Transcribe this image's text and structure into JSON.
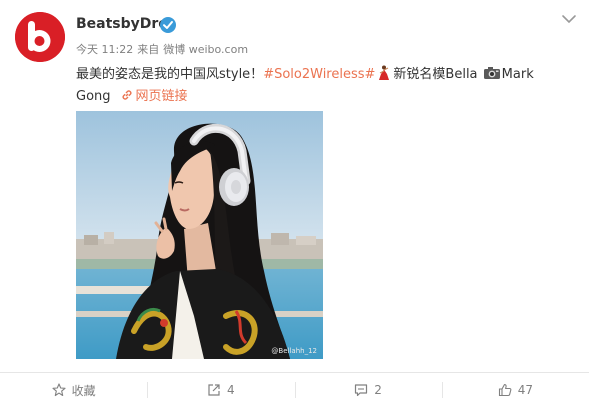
{
  "post": {
    "username": "BeatsbyDre",
    "time": "今天 11:22",
    "source_prefix": "来自",
    "source": "微博 weibo.com",
    "text_main": "最美的姿态是我的中国风style！",
    "topic": "#Solo2Wireless#",
    "model_label": "新锐名模Bella",
    "photographer": "Mark Gong",
    "link_label": "网页链接",
    "photo_watermark": "@Bellahh_12",
    "avatar_icon": "beats-logo-icon",
    "verified_icon": "verified-badge-icon"
  },
  "actions": {
    "favorite_label": "收藏",
    "repost_count": "4",
    "comment_count": "2",
    "like_count": "47"
  },
  "colors": {
    "accent": "#eb7350",
    "brand_red": "#d91f26",
    "verified_blue": "#3a9bd9",
    "meta_gray": "#808080"
  }
}
